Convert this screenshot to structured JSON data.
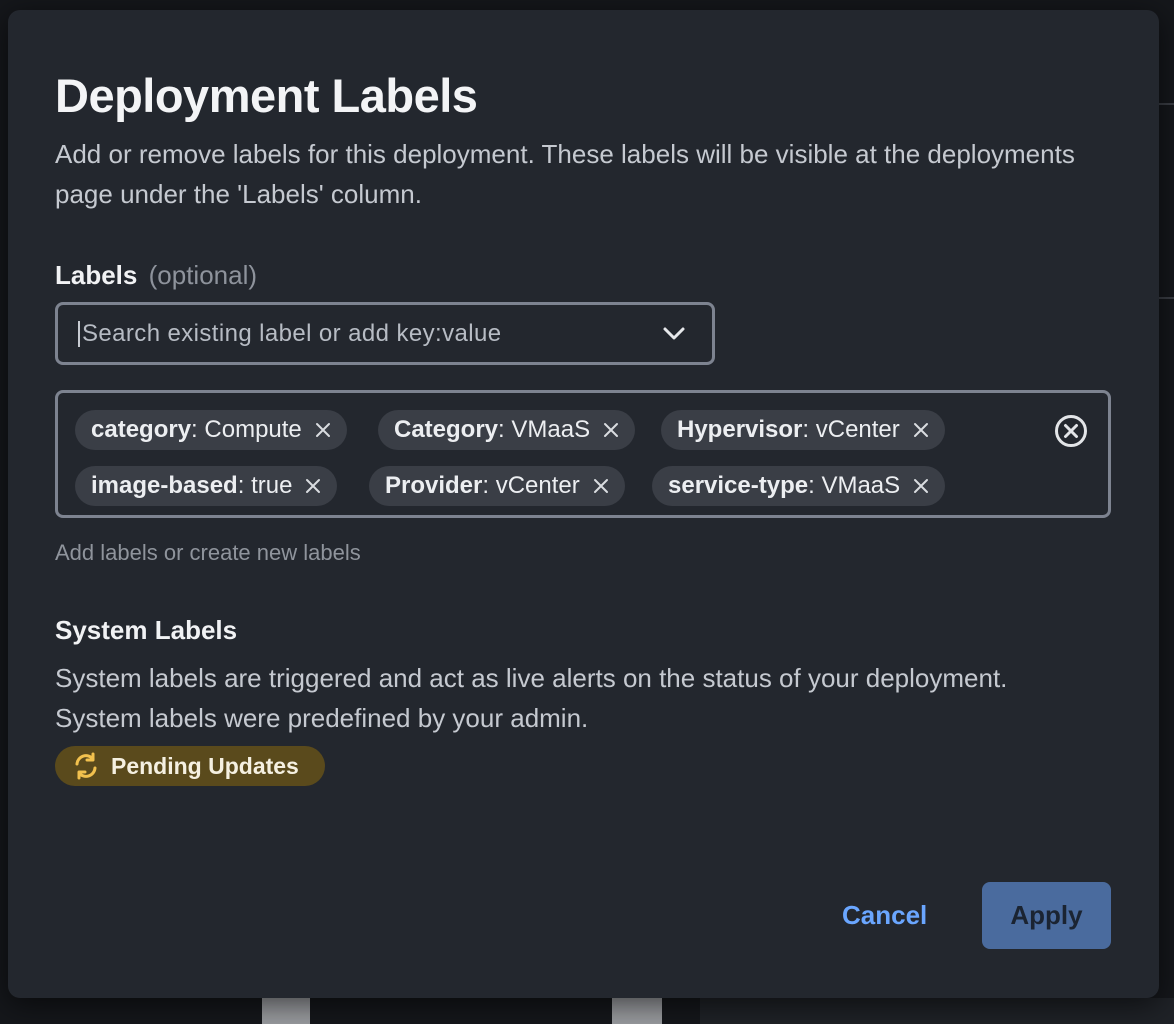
{
  "dialog": {
    "title": "Deployment Labels",
    "description": "Add or remove labels for this deployment. These labels will be visible at the deployments page under the 'Labels' column."
  },
  "labels": {
    "heading": "Labels",
    "optional": "(optional)",
    "search_placeholder": "Search existing label or add key:value",
    "helper": "Add labels or create new labels",
    "chips": [
      {
        "key": "category",
        "value": "Compute"
      },
      {
        "key": "Category",
        "value": "VMaaS"
      },
      {
        "key": "Hypervisor",
        "value": "vCenter"
      },
      {
        "key": "image-based",
        "value": "true"
      },
      {
        "key": "Provider",
        "value": "vCenter"
      },
      {
        "key": "service-type",
        "value": "VMaaS"
      }
    ]
  },
  "system_labels": {
    "heading": "System Labels",
    "description": "System labels are triggered and act as live alerts on the status of your deployment. System labels were predefined by your admin.",
    "badge": "Pending Updates",
    "badge_icon": "refresh-icon"
  },
  "actions": {
    "cancel": "Cancel",
    "apply": "Apply"
  },
  "colors": {
    "dialog_bg": "#23272e",
    "accent": "#6aa6ff",
    "apply_bg": "#4a6b9e",
    "badge_bg": "#5a4a1c",
    "badge_icon": "#f2c14e"
  }
}
